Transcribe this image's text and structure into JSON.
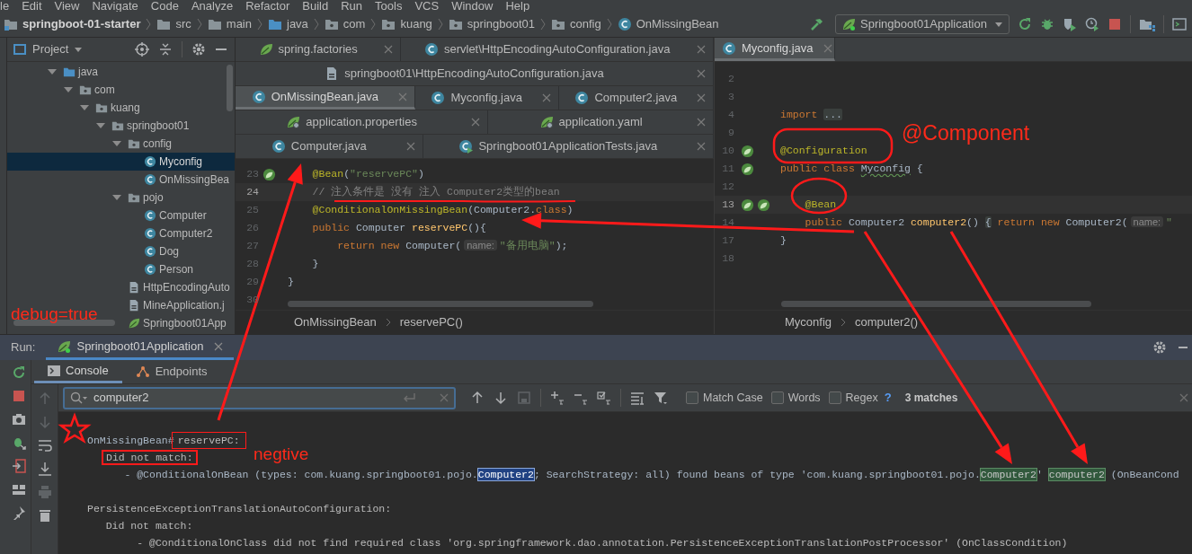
{
  "menu": [
    "le",
    "Edit",
    "View",
    "Navigate",
    "Code",
    "Analyze",
    "Refactor",
    "Build",
    "Run",
    "Tools",
    "VCS",
    "Window",
    "Help"
  ],
  "breadcrumbs": [
    {
      "label": "springboot-01-starter",
      "kind": "module"
    },
    {
      "label": "src",
      "kind": "folder"
    },
    {
      "label": "main",
      "kind": "folder"
    },
    {
      "label": "java",
      "kind": "source-folder"
    },
    {
      "label": "com",
      "kind": "package"
    },
    {
      "label": "kuang",
      "kind": "package"
    },
    {
      "label": "springboot01",
      "kind": "package"
    },
    {
      "label": "config",
      "kind": "package"
    },
    {
      "label": "OnMissingBean",
      "kind": "class"
    }
  ],
  "run_config": "Springboot01Application",
  "project": {
    "title": "Project",
    "tree": [
      {
        "label": "java",
        "kind": "source-folder",
        "expanded": true,
        "selected": false,
        "children": [
          {
            "label": "com",
            "kind": "package",
            "expanded": true,
            "selected": false,
            "children": [
              {
                "label": "kuang",
                "kind": "package",
                "expanded": true,
                "selected": false,
                "children": [
                  {
                    "label": "springboot01",
                    "kind": "package",
                    "expanded": true,
                    "selected": false,
                    "children": [
                      {
                        "label": "config",
                        "kind": "package",
                        "expanded": true,
                        "selected": false,
                        "children": [
                          {
                            "label": "Myconfig",
                            "kind": "class",
                            "selected": true
                          },
                          {
                            "label": "OnMissingBea",
                            "kind": "class",
                            "selected": false
                          }
                        ]
                      },
                      {
                        "label": "pojo",
                        "kind": "package",
                        "expanded": true,
                        "selected": false,
                        "children": [
                          {
                            "label": "Computer",
                            "kind": "class",
                            "selected": false
                          },
                          {
                            "label": "Computer2",
                            "kind": "class",
                            "selected": false
                          },
                          {
                            "label": "Dog",
                            "kind": "class",
                            "selected": false
                          },
                          {
                            "label": "Person",
                            "kind": "class",
                            "selected": false
                          }
                        ]
                      },
                      {
                        "label": "HttpEncodingAuto",
                        "kind": "java-file",
                        "selected": false
                      },
                      {
                        "label": "MineApplication.j",
                        "kind": "java-file",
                        "selected": false
                      },
                      {
                        "label": "Springboot01App",
                        "kind": "spring-class",
                        "selected": false
                      }
                    ]
                  }
                ]
              }
            ]
          }
        ]
      }
    ]
  },
  "editor_left": {
    "tab_rows": [
      {
        "tabs": [
          {
            "label": "spring.factories",
            "kind": "spring",
            "selected": false
          },
          {
            "label": "servlet\\HttpEncodingAutoConfiguration.java",
            "kind": "class",
            "selected": false
          }
        ]
      },
      {
        "tabs": [
          {
            "label": "springboot01\\HttpEncodingAutoConfiguration.java",
            "kind": "java-file",
            "selected": false
          }
        ]
      },
      {
        "tabs": [
          {
            "label": "OnMissingBean.java",
            "kind": "class",
            "selected": true
          },
          {
            "label": "Myconfig.java",
            "kind": "class",
            "selected": false
          },
          {
            "label": "Computer2.java",
            "kind": "class",
            "selected": false
          }
        ]
      },
      {
        "tabs": [
          {
            "label": "application.properties",
            "kind": "spring-config",
            "selected": false
          },
          {
            "label": "application.yaml",
            "kind": "spring-config",
            "selected": false
          }
        ]
      },
      {
        "tabs": [
          {
            "label": "Computer.java",
            "kind": "class",
            "selected": false
          },
          {
            "label": "Springboot01ApplicationTests.java",
            "kind": "test-class",
            "selected": false
          }
        ]
      }
    ],
    "lines": [
      {
        "number": "23",
        "current": false,
        "gutter": [
          {
            "kind": "bean"
          }
        ],
        "tokens": [
          {
            "text": "    @Bean",
            "kind": "annotation"
          },
          {
            "text": "(",
            "kind": "plain"
          },
          {
            "text": "\"reservePC\"",
            "kind": "string"
          },
          {
            "text": ")",
            "kind": "plain"
          }
        ]
      },
      {
        "number": "24",
        "current": true,
        "tokens": [
          {
            "text": "    // 注入条件是 没有 注入 Computer2类型的bean",
            "kind": "comment"
          }
        ]
      },
      {
        "number": "25",
        "current": false,
        "tokens": [
          {
            "text": "    @ConditionalOnMissingBean",
            "kind": "annotation"
          },
          {
            "text": "(Computer2.",
            "kind": "plain"
          },
          {
            "text": "class",
            "kind": "keyword"
          },
          {
            "text": ")",
            "kind": "plain"
          }
        ]
      },
      {
        "number": "26",
        "current": false,
        "tokens": [
          {
            "text": "    public ",
            "kind": "keyword"
          },
          {
            "text": "Computer ",
            "kind": "plain"
          },
          {
            "text": "reservePC",
            "kind": "method"
          },
          {
            "text": "(){",
            "kind": "plain"
          }
        ]
      },
      {
        "number": "27",
        "current": false,
        "tokens": [
          {
            "text": "        return new ",
            "kind": "keyword"
          },
          {
            "text": "Computer(",
            "kind": "plain"
          },
          {
            "text": "name:",
            "kind": "hint"
          },
          {
            "text": "\"备用电脑\"",
            "kind": "string"
          },
          {
            "text": ");",
            "kind": "plain"
          }
        ]
      },
      {
        "number": "28",
        "current": false,
        "tokens": [
          {
            "text": "    }",
            "kind": "plain"
          }
        ]
      },
      {
        "number": "29",
        "current": false,
        "tokens": [
          {
            "text": "}",
            "kind": "plain"
          }
        ]
      },
      {
        "number": "30",
        "current": false
      }
    ],
    "breadcrumbs": [
      "OnMissingBean",
      "reservePC()"
    ]
  },
  "editor_right": {
    "tab_rows": [
      {
        "tabs": [
          {
            "label": "Myconfig.java",
            "kind": "class",
            "selected": true
          }
        ]
      }
    ],
    "lines": [
      {
        "number": "2",
        "current": false
      },
      {
        "number": "3",
        "current": false
      },
      {
        "number": "4",
        "current": false,
        "tokens": [
          {
            "text": "import ",
            "kind": "keyword"
          },
          {
            "text": "...",
            "kind": "folded"
          }
        ]
      },
      {
        "number": "9",
        "current": false
      },
      {
        "number": "10",
        "current": false,
        "gutter": [
          {
            "kind": "bean"
          }
        ],
        "tokens": [
          {
            "text": "@Configuration",
            "kind": "annotation"
          }
        ]
      },
      {
        "number": "11",
        "current": false,
        "gutter": [
          {
            "kind": "bean"
          }
        ],
        "tokens": [
          {
            "text": "public class ",
            "kind": "keyword"
          },
          {
            "text": "Myconfig",
            "kind": "typo"
          },
          {
            "text": " {",
            "kind": "plain"
          }
        ]
      },
      {
        "number": "12",
        "current": false
      },
      {
        "number": "13",
        "current": true,
        "gutter": [
          {
            "kind": "bean"
          },
          {
            "kind": "bean"
          }
        ],
        "tokens": [
          {
            "text": "    @Bean",
            "kind": "annotation"
          }
        ]
      },
      {
        "number": "14",
        "current": false,
        "tokens": [
          {
            "text": "    public ",
            "kind": "keyword"
          },
          {
            "text": "Computer2 ",
            "kind": "plain"
          },
          {
            "text": "computer2",
            "kind": "method"
          },
          {
            "text": "() ",
            "kind": "plain"
          },
          {
            "text": "{",
            "kind": "folded"
          },
          {
            "text": " return new ",
            "kind": "keyword"
          },
          {
            "text": "Computer2(",
            "kind": "plain"
          },
          {
            "text": "name:",
            "kind": "hint"
          },
          {
            "text": "\"",
            "kind": "string"
          }
        ]
      },
      {
        "number": "17",
        "current": false,
        "tokens": [
          {
            "text": "}",
            "kind": "plain"
          }
        ]
      },
      {
        "number": "18",
        "current": false
      }
    ],
    "breadcrumbs": [
      "Myconfig",
      "computer2()"
    ]
  },
  "run": {
    "label": "Run:",
    "tab": "Springboot01Application",
    "tabs": [
      {
        "label": "Console",
        "selected": true
      },
      {
        "label": "Endpoints",
        "selected": false
      }
    ],
    "search": {
      "value": "computer2",
      "options": [
        {
          "label": "Match Case",
          "checked": false
        },
        {
          "label": "Words",
          "checked": false
        },
        {
          "label": "Regex",
          "checked": false
        }
      ],
      "help": "?",
      "matches": "3 matches"
    },
    "console": [
      {
        "lines": [
          {
            "tokens": [
              {
                "text": "OnMissingBean#",
                "kind": "plain"
              },
              {
                "text": "reservePC:",
                "kind": "boxed"
              }
            ]
          },
          {
            "tokens": [
              {
                "text": "Did not match:",
                "kind": "boxed-thick"
              }
            ]
          },
          {
            "tokens": [
              {
                "text": "      - @ConditionalOnBean (types: com.kuang.springboot01.pojo.",
                "kind": "plain"
              },
              {
                "text": "Computer2",
                "kind": "current"
              },
              {
                "text": "; SearchStrategy: all) found beans of type 'com.kuang.springboot01.pojo.",
                "kind": "plain"
              },
              {
                "text": "Computer2",
                "kind": "match"
              },
              {
                "text": "' ",
                "kind": "plain"
              },
              {
                "text": "computer2",
                "kind": "match"
              },
              {
                "text": " (OnBeanCond",
                "kind": "plain"
              }
            ]
          }
        ]
      },
      {
        "lines": [
          {
            "text": "PersistenceExceptionTranslationAutoConfiguration:"
          },
          {
            "text": "   Did not match:"
          },
          {
            "text": "        - @ConditionalOnClass did not find required class 'org.springframework.dao.annotation.PersistenceExceptionTranslationPostProcessor' (OnClassCondition)"
          }
        ]
      }
    ]
  },
  "annotations": [
    {
      "text": "@Component"
    },
    {
      "text": "debug=true"
    },
    {
      "text": "negtive"
    }
  ]
}
